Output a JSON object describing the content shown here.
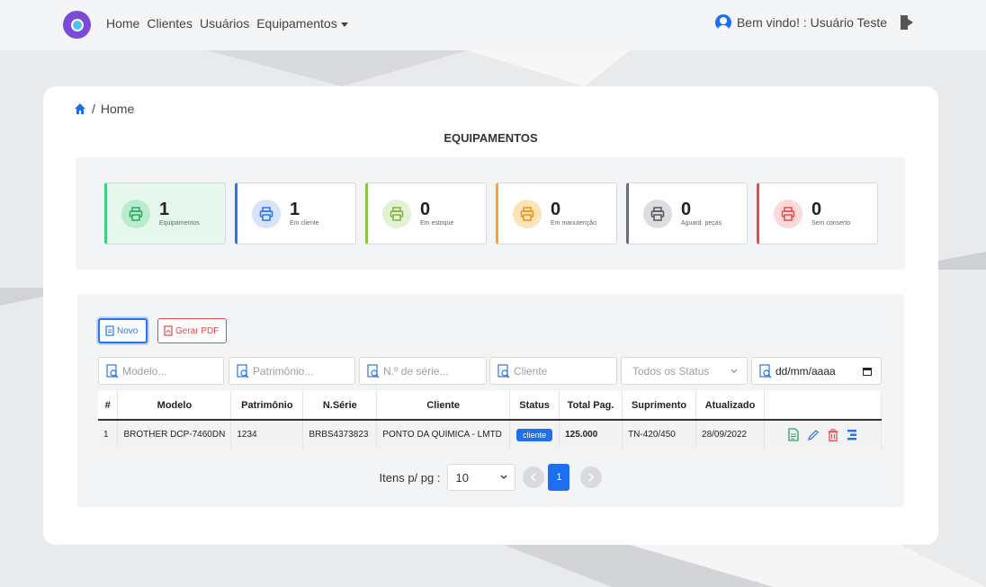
{
  "nav": {
    "home": "Home",
    "clientes": "Clientes",
    "usuarios": "Usuários",
    "equipamentos": "Equipamentos",
    "welcome": "Bem vindo! : Usuário Teste"
  },
  "breadcrumb": {
    "current": "Home"
  },
  "page_title": "EQUIPAMENTOS",
  "stats": [
    {
      "value": "1",
      "label": "Equipamentos",
      "color": "#3fcf7f"
    },
    {
      "value": "1",
      "label": "Em cliente",
      "color": "#2a74e8"
    },
    {
      "value": "0",
      "label": "Em estoque",
      "color": "#8bc34a"
    },
    {
      "value": "0",
      "label": "Em manutenção",
      "color": "#f5a623"
    },
    {
      "value": "0",
      "label": "Aguard. peças",
      "color": "#6b6f75"
    },
    {
      "value": "0",
      "label": "Sem conserto",
      "color": "#e84a4a"
    }
  ],
  "buttons": {
    "novo": "Novo",
    "pdf": "Gerar PDF"
  },
  "filters": {
    "modelo": "Modelo...",
    "patrimonio": "Patrimônio...",
    "serie": "N.º de série...",
    "cliente": "Cliente",
    "status": "Todos os Status",
    "date": "dd/mm/aaaa"
  },
  "table": {
    "headers": [
      "#",
      "Modelo",
      "Patrimônio",
      "N.Série",
      "Cliente",
      "Status",
      "Total Pag.",
      "Suprimento",
      "Atualizado",
      ""
    ],
    "rows": [
      [
        "1",
        "BROTHER DCP-7460DN",
        "1234",
        "BRBS4373823",
        "PONTO DA QUIMICA - LMTD",
        "cliente",
        "125.000",
        "TN-420/450",
        "28/09/2022"
      ]
    ]
  },
  "pager": {
    "label": "Itens p/ pg :",
    "per_page": "10",
    "current_page": "1"
  }
}
